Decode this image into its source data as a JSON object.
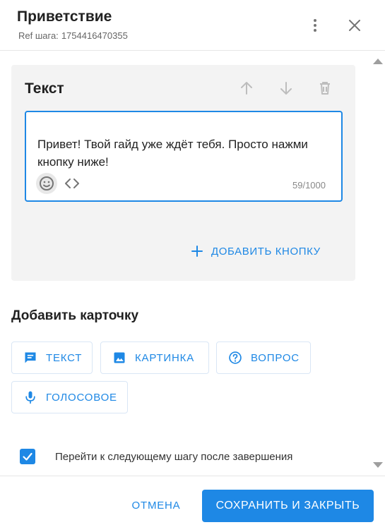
{
  "header": {
    "title": "Приветствие",
    "ref_label": "Ref шага:",
    "ref_value": "1754416470355",
    "more_icon": "more-vertical-icon",
    "close_icon": "close-icon"
  },
  "card": {
    "title": "Текст",
    "actions": [
      "arrow-up-icon",
      "arrow-down-icon",
      "trash-icon"
    ],
    "editor": {
      "value": "Привет! Твой гайд уже ждёт тебя. Просто нажми кнопку ниже!",
      "counter": "59/1000"
    },
    "add_button_label": "ДОБАВИТЬ КНОПКУ"
  },
  "add_card": {
    "title": "Добавить карточку",
    "buttons": {
      "text": "ТЕКСТ",
      "image": "КАРТИНКА",
      "question": "ВОПРОС",
      "voice": "ГОЛОСОВОЕ"
    }
  },
  "next_step": {
    "checked": true,
    "label": "Перейти к следующему шагу после завершения"
  },
  "footer": {
    "cancel_label": "ОТМЕНА",
    "save_label": "СОХРАНИТЬ И ЗАКРЫТЬ"
  },
  "colors": {
    "accent": "#1e88e5",
    "card_bg": "#f3f3f3",
    "icon_gray": "#9e9e9e"
  }
}
